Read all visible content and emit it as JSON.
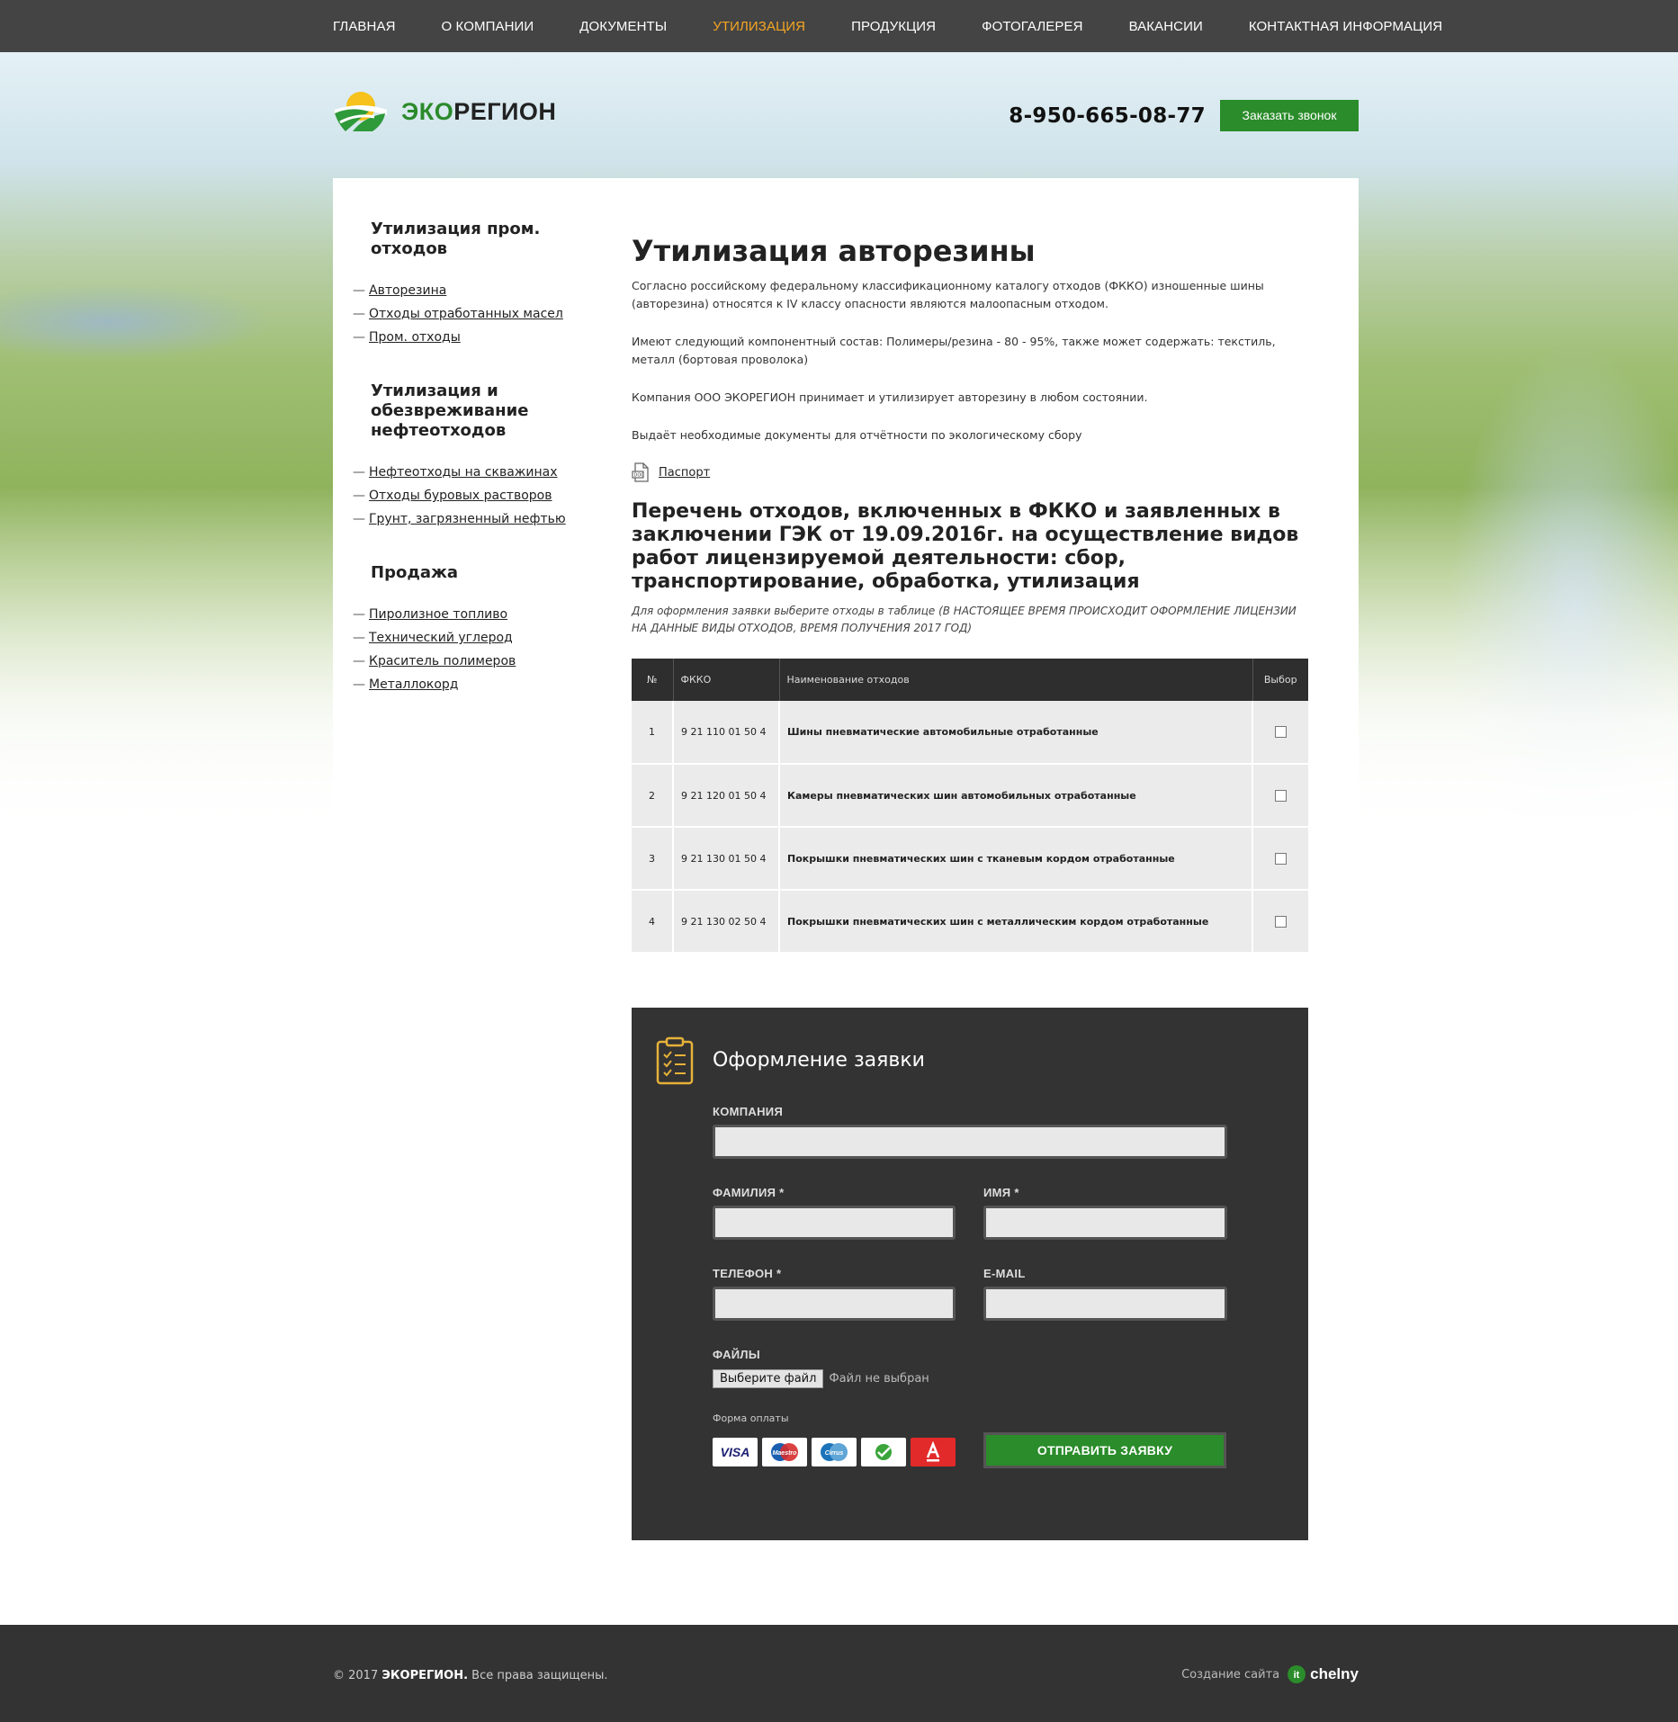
{
  "nav": {
    "items": [
      "ГЛАВНАЯ",
      "О КОМПАНИИ",
      "ДОКУМЕНТЫ",
      "УТИЛИЗАЦИЯ",
      "ПРОДУКЦИЯ",
      "ФОТОГАЛЕРЕЯ",
      "ВАКАНСИИ",
      "КОНТАКТНАЯ ИНФОРМАЦИЯ"
    ],
    "active_index": 3
  },
  "header": {
    "logo_part1": "ЭКО",
    "logo_part2": "РЕГИОН",
    "phone": "8-950-665-08-77",
    "call_button": "Заказать звонок"
  },
  "sidebar": {
    "groups": [
      {
        "title": "Утилизация пром. отходов",
        "items": [
          "Авторезина",
          "Отходы отработанных масел",
          "Пром. отходы"
        ]
      },
      {
        "title": "Утилизация и обезвреживание нефтеотходов",
        "items": [
          "Нефтеотходы на скважинах",
          "Отходы буровых растворов",
          "Грунт, загрязненный нефтью"
        ]
      },
      {
        "title": "Продажа",
        "items": [
          "Пиролизное топливо",
          "Технический углерод",
          "Краситель полимеров",
          "Металлокорд"
        ]
      }
    ]
  },
  "main": {
    "title": "Утилизация авторезины",
    "p1": "Согласно российскому федеральному классификационному каталогу отходов (ФККО) изношенные шины (авторезина) относятся к IV классу опасности являются малоопасным отходом.",
    "p2": "Имеют следующий компонентный состав: Полимеры/резина - 80 - 95%, также может содержать: текстиль, металл (бортовая проволока)",
    "p3": "Компания ООО ЭКОРЕГИОН принимает и утилизирует авторезину в любом состоянии.",
    "p4": "Выдаёт необходимые документы для отчётности по экологическому сбору",
    "passport_link": "Паспорт",
    "list_title": "Перечень отходов, включенных в ФККО и заявленных в заключении ГЭК от 19.09.2016г. на осуществление видов работ лицензируемой деятельности: сбор, транспортирование, обработка, утилизация",
    "note": "Для оформления заявки выберите отходы в таблице (В НАСТОЯЩЕЕ ВРЕМЯ ПРОИСХОДИТ ОФОРМЛЕНИЕ ЛИЦЕНЗИИ НА ДАННЫЕ ВИДЫ ОТХОДОВ, ВРЕМЯ ПОЛУЧЕНИЯ 2017 ГОД)"
  },
  "table": {
    "headers": [
      "№",
      "ФККО",
      "Наименование отходов",
      "Выбор"
    ],
    "rows": [
      {
        "n": "1",
        "code": "9 21 110 01 50 4",
        "name": "Шины пневматические автомобильные отработанные"
      },
      {
        "n": "2",
        "code": "9 21 120 01 50 4",
        "name": "Камеры пневматических шин автомобильных отработанные"
      },
      {
        "n": "3",
        "code": "9 21 130 01 50 4",
        "name": "Покрышки пневматических шин с тканевым кордом отработанные"
      },
      {
        "n": "4",
        "code": "9 21 130 02 50 4",
        "name": "Покрышки пневматических шин с металлическим кордом отработанные"
      }
    ]
  },
  "form": {
    "title": "Оформление заявки",
    "company_label": "КОМПАНИЯ",
    "surname_label": "ФАМИЛИЯ *",
    "name_label": "ИМЯ *",
    "phone_label": "ТЕЛЕФОН *",
    "email_label": "E-MAIL",
    "files_label": "ФАЙЛЫ",
    "file_button": "Выберите файл",
    "file_status": "Файл не выбран",
    "payment_label": "Форма оплаты",
    "payment_methods": [
      "VISA",
      "Maestro",
      "Cirrus",
      "Сбербанк",
      "Альфа-Банк"
    ],
    "submit": "ОТПРАВИТЬ ЗАЯВКУ"
  },
  "footer": {
    "copyright_prefix": "© 2017",
    "brand": "ЭКОРЕГИОН.",
    "rights": "Все права защищены.",
    "credit_text": "Создание сайта",
    "credit_brand": "chelny"
  },
  "colors": {
    "accent_green": "#2a8c2a",
    "nav_active": "#f5a623",
    "nav_bg": "#444444",
    "form_bg": "#333333"
  }
}
